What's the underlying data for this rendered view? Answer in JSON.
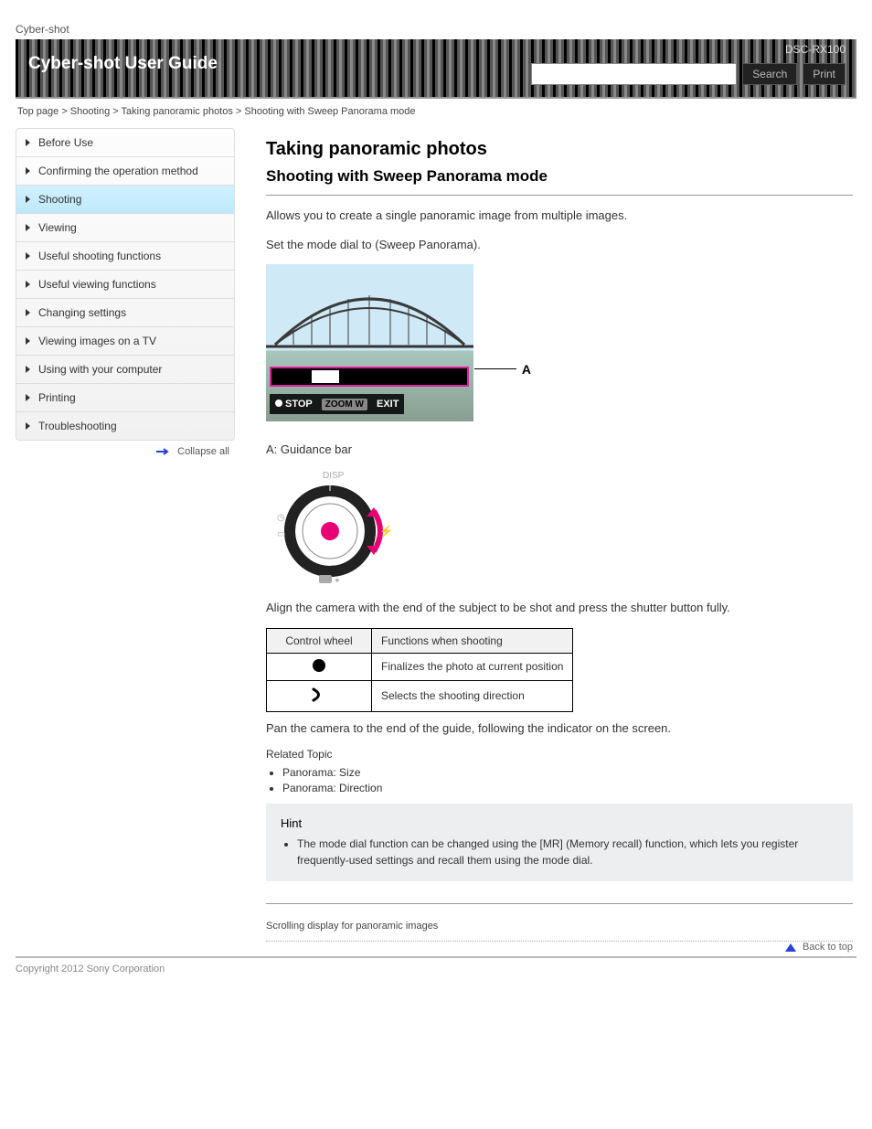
{
  "top_label": "Cyber-shot",
  "banner": {
    "title": "Cyber-shot User Guide",
    "model": "DSC-RX100",
    "search_label": "Search",
    "print_label": "Print"
  },
  "breadcrumb": "Top page > Shooting > Taking panoramic photos > Shooting with Sweep Panorama mode",
  "sidebar": {
    "items": [
      "Before Use",
      "Confirming the operation method",
      "Shooting",
      "Viewing",
      "Useful shooting functions",
      "Useful viewing functions",
      "Changing settings",
      "Viewing images on a TV",
      "Using with your computer",
      "Printing",
      "Troubleshooting"
    ],
    "active_index": 2,
    "collapse_label": "Collapse all"
  },
  "content": {
    "h2": "Taking panoramic photos",
    "h3": "Shooting with Sweep Panorama mode",
    "intro": "Allows you to create a single panoramic image from multiple images.",
    "step1": "Set the mode dial to  (Sweep Panorama).",
    "camera_osd": {
      "stop": "STOP",
      "zoom": "ZOOM W",
      "exit": "EXIT"
    },
    "label_A": "A",
    "caption_A": "A: Guidance bar",
    "wheel_step": "Align the camera with the end of the subject to be shot and press the shutter button fully.",
    "pan_step": "Pan the camera to the end of the guide, following the indicator on the screen.",
    "wheel_labels": {
      "top": "DISP"
    },
    "table": {
      "head": [
        "Control wheel",
        "Functions when shooting"
      ],
      "rows": [
        {
          "icon": "dot",
          "label": "Finalizes the photo at current position"
        },
        {
          "icon": "right",
          "label": "Selects the shooting direction"
        }
      ]
    },
    "bullets": [
      "Panorama: Size",
      "Panorama: Direction"
    ],
    "related_label": "Related Topic",
    "hint_title": "Hint",
    "hint_text": "The mode dial function can be changed using the [MR] (Memory recall) function, which lets you register frequently-used settings and recall them using the mode dial.",
    "links": "Scrolling display for panoramic images",
    "back_top": "Back to top"
  },
  "copyright": "Copyright 2012 Sony Corporation"
}
